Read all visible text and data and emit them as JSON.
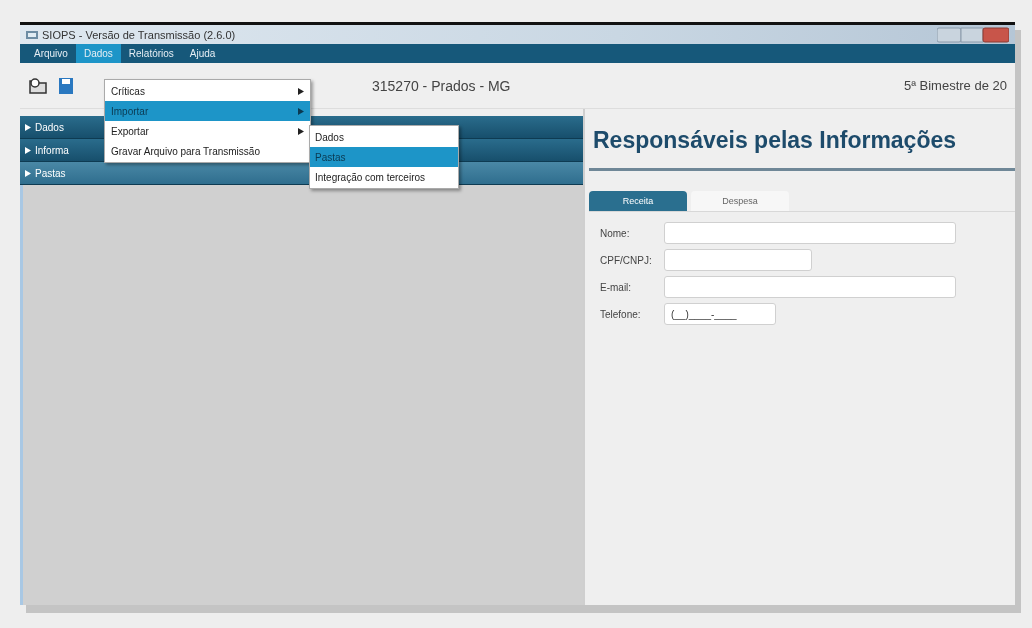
{
  "window": {
    "title": "SIOPS - Versão de Transmissão (2.6.0)"
  },
  "menu_bar": [
    {
      "label": "Arquivo",
      "selected": false
    },
    {
      "label": "Dados",
      "selected": true
    },
    {
      "label": "Relatórios",
      "selected": false
    },
    {
      "label": "Ajuda",
      "selected": false
    }
  ],
  "dropdown": [
    {
      "label": "Críticas",
      "submenu": true,
      "selected": false
    },
    {
      "label": "Importar",
      "submenu": true,
      "selected": true
    },
    {
      "label": "Exportar",
      "submenu": true,
      "selected": false
    },
    {
      "label": "Gravar Arquivo para Transmissão",
      "submenu": false,
      "selected": false
    }
  ],
  "submenu": [
    {
      "label": "Dados",
      "selected": false
    },
    {
      "label": "Pastas",
      "selected": true
    },
    {
      "label": "Integração com terceiros",
      "selected": false
    }
  ],
  "toolbar": {
    "location": "315270 - Prados - MG",
    "period": "5ª Bimestre de 20"
  },
  "sidebar": {
    "items": [
      {
        "label": "Dados",
        "selected": false
      },
      {
        "label": "Informa",
        "selected": false
      },
      {
        "label": "Pastas",
        "selected": true
      }
    ]
  },
  "panel": {
    "title": "Responsáveis pelas Informações",
    "tabs": [
      {
        "label": "Receita",
        "selected": true
      },
      {
        "label": "Despesa",
        "selected": false
      }
    ],
    "fields": [
      {
        "label": "Nome:",
        "kind": "wide"
      },
      {
        "label": "CPF/CNPJ:",
        "kind": "medium"
      },
      {
        "label": "E-mail:",
        "kind": "wide"
      },
      {
        "label": "Telefone:",
        "kind": "short",
        "value": "(__)____-____"
      }
    ]
  }
}
